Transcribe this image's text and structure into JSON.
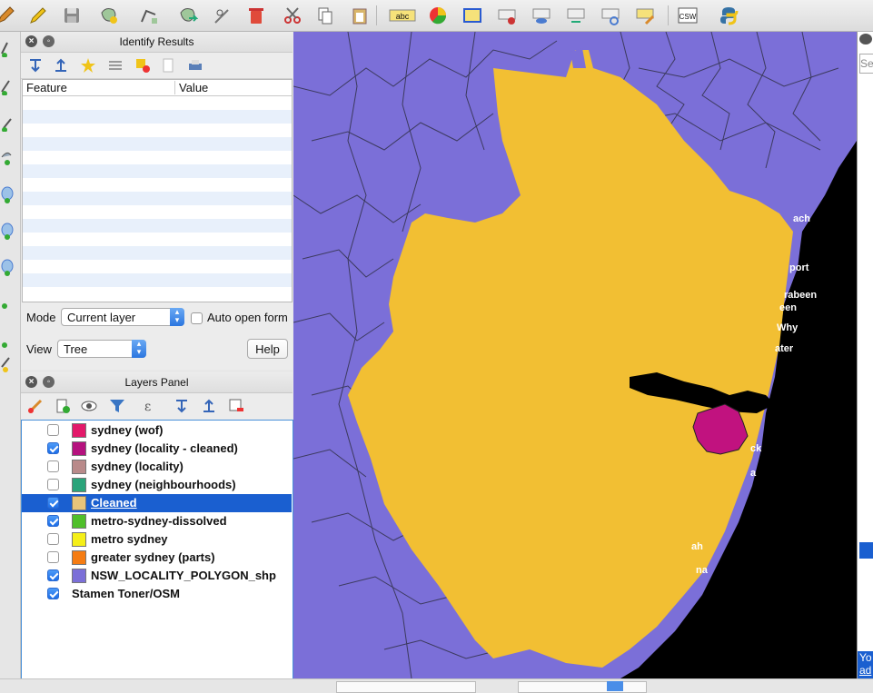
{
  "toolbar": {
    "icons": [
      "pencil-icon",
      "save-layer-icon",
      "add-feature-icon",
      "node-tool-icon",
      "move-feature-icon",
      "node-editor-icon",
      "delete-icon",
      "cut-icon",
      "copy-icon",
      "paste-icon",
      "label-icon",
      "diagram-icon",
      "label-pin-icon",
      "label-highlight-icon",
      "show-label-icon",
      "move-label-icon",
      "rotate-label-icon",
      "change-label-icon",
      "csw-icon",
      "python-icon"
    ],
    "label_abc": "abc",
    "csw": "CSW"
  },
  "identify": {
    "title": "Identify Results",
    "col_feature": "Feature",
    "col_value": "Value",
    "mode_label": "Mode",
    "mode_value": "Current layer",
    "auto_open": "Auto open form",
    "view_label": "View",
    "view_value": "Tree",
    "help": "Help"
  },
  "layers": {
    "title": "Layers Panel",
    "items": [
      {
        "name": "sydney (wof)",
        "checked": false,
        "color": "#e3196a"
      },
      {
        "name": "sydney (locality - cleaned)",
        "checked": true,
        "color": "#b5127e"
      },
      {
        "name": "sydney (locality)",
        "checked": false,
        "color": "#b98a8a"
      },
      {
        "name": "sydney (neighbourhoods)",
        "checked": false,
        "color": "#2aa47a"
      },
      {
        "name": "Cleaned",
        "checked": true,
        "color": "#e8c47a",
        "selected": true
      },
      {
        "name": "metro-sydney-dissolved",
        "checked": true,
        "color": "#4fbf2a"
      },
      {
        "name": "metro sydney",
        "checked": false,
        "color": "#f5ef18"
      },
      {
        "name": "greater sydney (parts)",
        "checked": false,
        "color": "#f57c12"
      },
      {
        "name": "NSW_LOCALITY_POLYGON_shp",
        "checked": true,
        "color": "#7b6fd8"
      },
      {
        "name": "Stamen Toner/OSM",
        "checked": true,
        "color": null
      }
    ]
  },
  "map": {
    "colors": {
      "locality": "#7b6fd8",
      "dissolved": "#f2bf33",
      "cleaned": "#c1127f",
      "ocean": "#000000"
    },
    "coast_labels": [
      "ach",
      "port",
      "rabeen",
      "een",
      "Why",
      "ater",
      "ck",
      "a",
      "ah",
      "na"
    ]
  },
  "right_panel": {
    "search_fragment": "Se",
    "footer1": "Yo",
    "footer2": "ad"
  }
}
